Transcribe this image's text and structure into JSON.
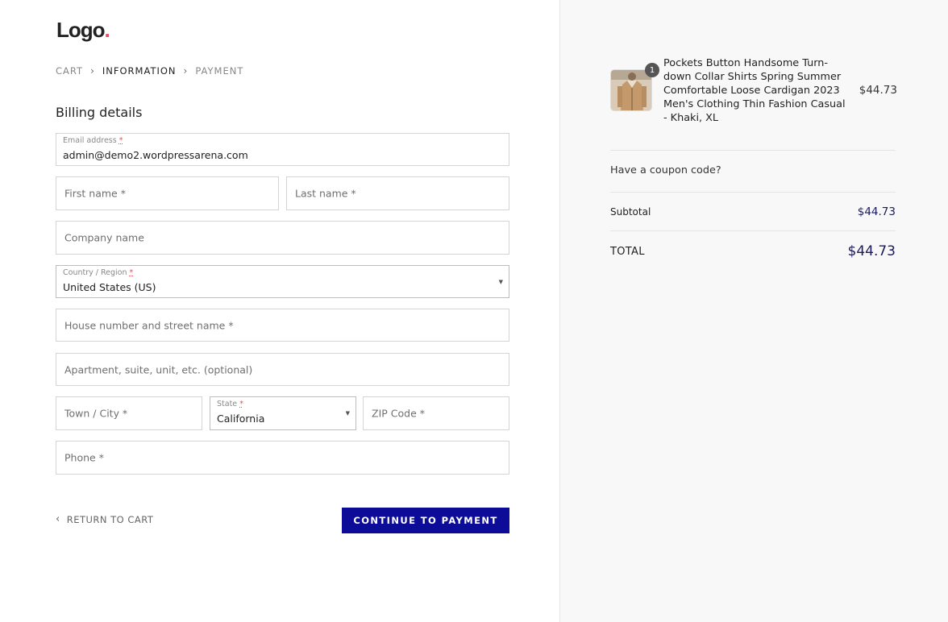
{
  "logo": {
    "text": "Logo",
    "dot": "."
  },
  "breadcrumbs": [
    {
      "label": "CART",
      "active": false
    },
    {
      "label": "INFORMATION",
      "active": true
    },
    {
      "label": "PAYMENT",
      "active": false
    }
  ],
  "breadcrumb_separator": "›",
  "billing": {
    "title": "Billing details",
    "email": {
      "label": "Email address",
      "required_mark": "*",
      "value": "admin@demo2.wordpressarena.com"
    },
    "first_name": {
      "placeholder": "First name *"
    },
    "last_name": {
      "placeholder": "Last name *"
    },
    "company": {
      "placeholder": "Company name"
    },
    "country": {
      "label": "Country / Region",
      "required_mark": "*",
      "value": "United States (US)"
    },
    "street": {
      "placeholder": "House number and street name *"
    },
    "apartment": {
      "placeholder": "Apartment, suite, unit, etc. (optional)"
    },
    "city": {
      "placeholder": "Town / City *"
    },
    "state": {
      "label": "State",
      "required_mark": "*",
      "value": "California"
    },
    "zip": {
      "placeholder": "ZIP Code *"
    },
    "phone": {
      "placeholder": "Phone *"
    }
  },
  "actions": {
    "return_label": "RETURN TO CART",
    "continue_label": "CONTINUE TO PAYMENT"
  },
  "summary": {
    "product": {
      "quantity": "1",
      "name": "Pockets Button Handsome Turn-down Collar Shirts Spring Summer Comfortable Loose Cardigan 2023 Men's Clothing Thin Fashion Casual - Khaki, XL",
      "price": "$44.73"
    },
    "coupon_label": "Have a coupon code?",
    "subtotal_label": "Subtotal",
    "subtotal_value": "$44.73",
    "total_label": "TOTAL",
    "total_value": "$44.73"
  },
  "colors": {
    "accent_button": "#0c0c99",
    "price_text": "#1a1a5e",
    "logo_dot": "#e54d5d"
  }
}
